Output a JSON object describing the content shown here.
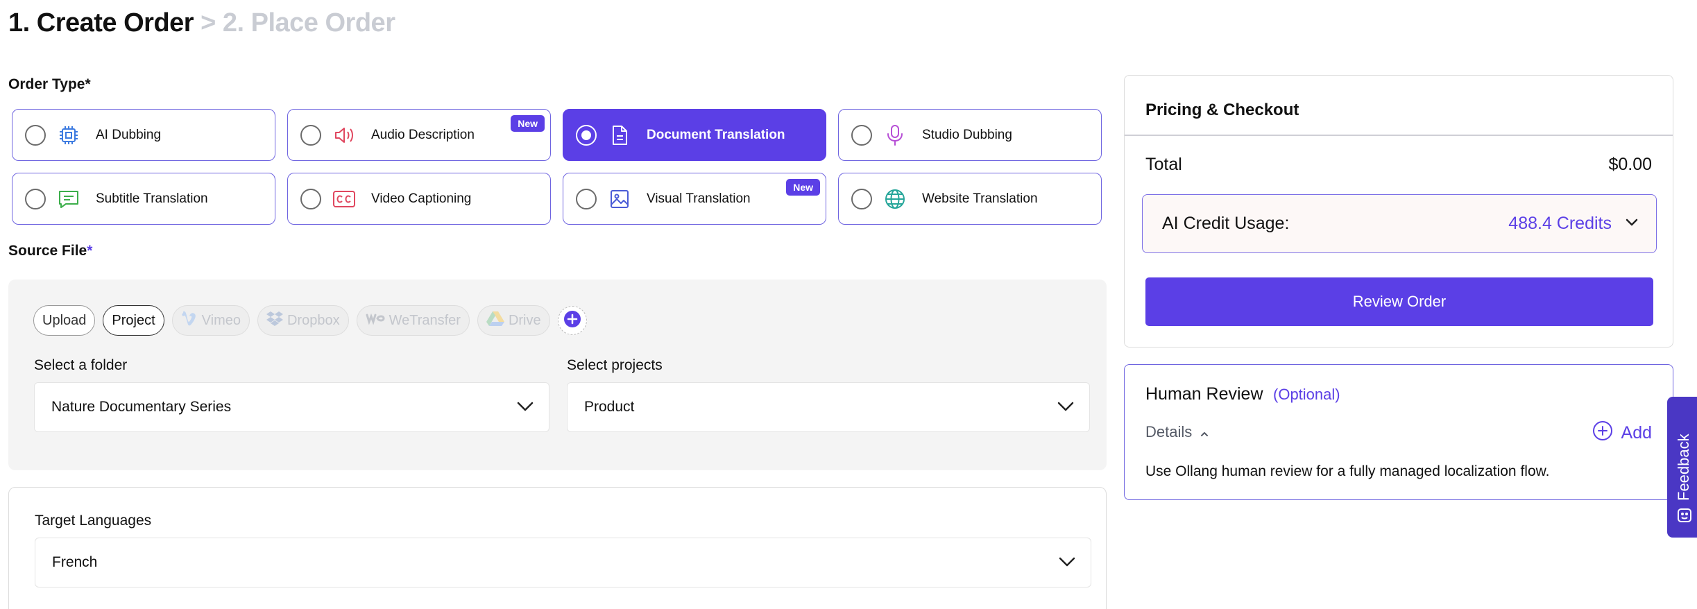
{
  "header": {
    "step1": "1. Create Order",
    "step2": " > 2. Place Order"
  },
  "order_type": {
    "label": "Order Type",
    "required_mark": "*",
    "options": [
      {
        "label": "AI Dubbing",
        "icon": "chip-icon",
        "selected": false,
        "badge": ""
      },
      {
        "label": "Audio Description",
        "icon": "speaker-icon",
        "selected": false,
        "badge": "New"
      },
      {
        "label": "Document Translation",
        "icon": "document-icon",
        "selected": true,
        "badge": ""
      },
      {
        "label": "Studio Dubbing",
        "icon": "microphone-icon",
        "selected": false,
        "badge": ""
      },
      {
        "label": "Subtitle Translation",
        "icon": "message-icon",
        "selected": false,
        "badge": ""
      },
      {
        "label": "Video Captioning",
        "icon": "cc-icon",
        "selected": false,
        "badge": ""
      },
      {
        "label": "Visual Translation",
        "icon": "image-icon",
        "selected": false,
        "badge": "New"
      },
      {
        "label": "Website Translation",
        "icon": "globe-icon",
        "selected": false,
        "badge": ""
      }
    ]
  },
  "source_file": {
    "label": "Source File",
    "required_mark": "*",
    "sources": [
      {
        "label": "Upload",
        "state": "normal"
      },
      {
        "label": "Project",
        "state": "active"
      },
      {
        "label": "Vimeo",
        "state": "disabled",
        "icon": "vimeo-icon"
      },
      {
        "label": "Dropbox",
        "state": "disabled",
        "icon": "dropbox-icon"
      },
      {
        "label": "WeTransfer",
        "state": "disabled",
        "icon": "wetransfer-icon"
      },
      {
        "label": "Drive",
        "state": "disabled",
        "icon": "drive-icon"
      }
    ],
    "folder_label": "Select a folder",
    "folder_value": "Nature Documentary Series",
    "projects_label": "Select projects",
    "projects_value": "Product"
  },
  "target": {
    "label": "Target Languages",
    "value": "French"
  },
  "pricing": {
    "title": "Pricing & Checkout",
    "total_label": "Total",
    "total_value": "$0.00",
    "credit_label": "AI Credit Usage:",
    "credit_value": "488.4 Credits",
    "review_button": "Review Order"
  },
  "human_review": {
    "title": "Human Review",
    "optional": "(Optional)",
    "details": "Details",
    "add": "Add",
    "description": "Use Ollang human review for a fully managed localization flow."
  },
  "feedback": {
    "label": "Feedback"
  },
  "colors": {
    "accent": "#5b3fe6",
    "feedback_bg": "#4a37c4"
  }
}
